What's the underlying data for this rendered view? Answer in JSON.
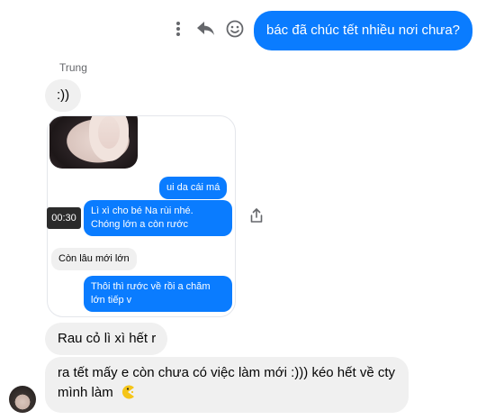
{
  "top": {
    "message": "bác đã chúc tết nhiều nơi chưa?",
    "icons": [
      "more-vertical-icon",
      "reply-icon",
      "emoji-icon"
    ]
  },
  "thread": {
    "sender_name": "Trung",
    "msg1": ":))",
    "card": {
      "duration": "00:30",
      "bubble1": "ui da cái má",
      "bubble2": "Lì xì cho bé Na rùi nhé. Chóng lớn a còn rước",
      "bubble3": "Còn lâu mới lớn",
      "bubble4": "Thôi thì rước về rồi a chăm lớn tiếp v"
    },
    "msg2": "Rau cỏ lì xì hết r",
    "msg3": "ra tết mấy e còn chưa có việc làm mới :))) kéo hết về cty mình làm"
  },
  "colors": {
    "outgoing": "#0a7cff",
    "incoming": "#f0f0f0"
  }
}
